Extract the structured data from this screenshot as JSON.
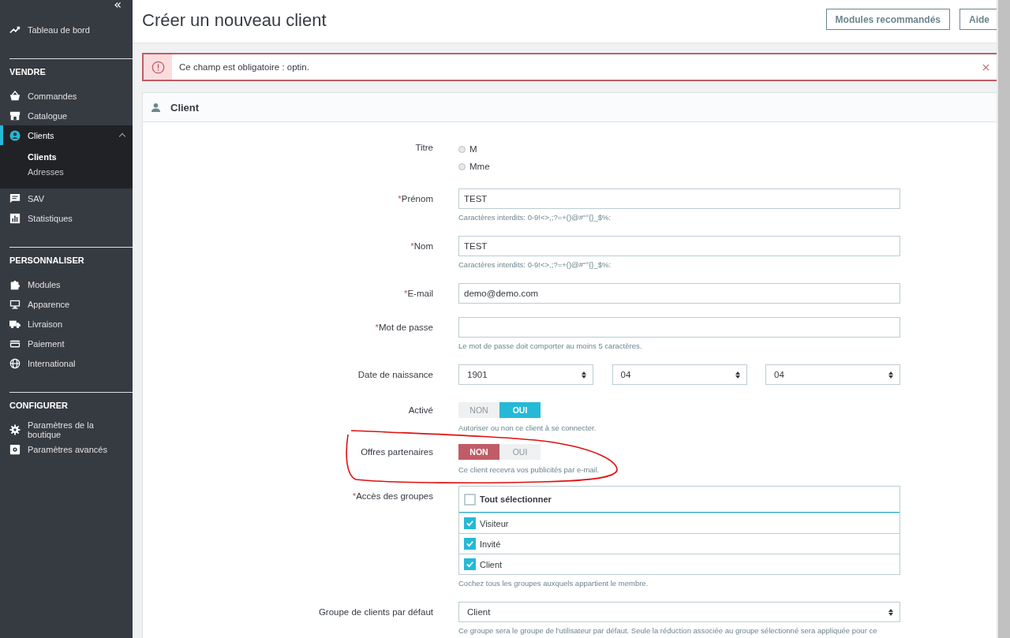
{
  "sidebar": {
    "collapse_icon": "«",
    "top": [
      {
        "label": "Tableau de bord",
        "selected": false
      }
    ],
    "sections": [
      {
        "title": "VENDRE",
        "items": [
          {
            "label": "Commandes",
            "selected": false
          },
          {
            "label": "Catalogue",
            "selected": false
          },
          {
            "label": "Clients",
            "selected": true,
            "expanded": true,
            "children": [
              {
                "label": "Clients",
                "selected": true
              },
              {
                "label": "Adresses",
                "selected": false
              }
            ]
          },
          {
            "label": "SAV",
            "selected": false
          },
          {
            "label": "Statistiques",
            "selected": false
          }
        ]
      },
      {
        "title": "PERSONNALISER",
        "items": [
          {
            "label": "Modules",
            "selected": false
          },
          {
            "label": "Apparence",
            "selected": false
          },
          {
            "label": "Livraison",
            "selected": false
          },
          {
            "label": "Paiement",
            "selected": false
          },
          {
            "label": "International",
            "selected": false
          }
        ]
      },
      {
        "title": "CONFIGURER",
        "items": [
          {
            "label": "Paramètres de la boutique",
            "selected": false
          },
          {
            "label": "Paramètres avancés",
            "selected": false
          }
        ]
      }
    ]
  },
  "header": {
    "title": "Créer un nouveau client",
    "buttons": [
      "Modules recommandés",
      "Aide"
    ]
  },
  "alert": {
    "message": "Ce champ est obligatoire : optin."
  },
  "card": {
    "title": "Client",
    "rows": [
      {
        "kind": "radio",
        "label": "Titre",
        "options": [
          {
            "label": "M",
            "selected": false
          },
          {
            "label": "Mme",
            "selected": false
          }
        ]
      },
      {
        "kind": "text",
        "label": "Prénom",
        "mark": "*",
        "value": "TEST",
        "hint": "Caractères interdits: 0-9!<>,;?=+()@#\"°{}_$%:"
      },
      {
        "kind": "text",
        "label": "Nom",
        "mark": "*",
        "value": "TEST",
        "hint": "Caractères interdits: 0-9!<>,;?=+()@#\"°{}_$%:"
      },
      {
        "kind": "text",
        "label": "E-mail",
        "mark": "*",
        "value": "demo@demo.com"
      },
      {
        "kind": "text",
        "label": "Mot de passe",
        "mark": "*",
        "value": "",
        "hint": "Le mot de passe doit comporter au moins 5 caractères."
      },
      {
        "kind": "date",
        "label": "Date de naissance",
        "values": [
          "1901",
          "04",
          "04"
        ]
      },
      {
        "kind": "switch",
        "label": "Activé",
        "options": [
          {
            "label": "NON",
            "selected": false
          },
          {
            "label": "OUI",
            "selected": true
          }
        ],
        "hint": "Autoriser ou non ce client à se connecter."
      },
      {
        "kind": "switch",
        "label": "Offres partenaires",
        "options": [
          {
            "label": "NON",
            "selected": true
          },
          {
            "label": "OUI",
            "selected": false
          }
        ],
        "hint": "Ce client recevra vos publicités par e-mail."
      },
      {
        "kind": "checklist",
        "label": "Accès des groupes",
        "mark": "*",
        "header": {
          "label": "Tout sélectionner",
          "checked": false
        },
        "items": [
          {
            "label": "Visiteur",
            "checked": true
          },
          {
            "label": "Invité",
            "checked": true
          },
          {
            "label": "Client",
            "checked": true
          }
        ],
        "hint": "Cochez tous les groupes auxquels appartient le membre."
      },
      {
        "kind": "select",
        "label": "Groupe de clients par défaut",
        "value": "Client",
        "hint": "Ce groupe sera le groupe de l'utilisateur par défaut. Seule la réduction associée au groupe sélectionné sera appliquée pour ce"
      }
    ]
  }
}
